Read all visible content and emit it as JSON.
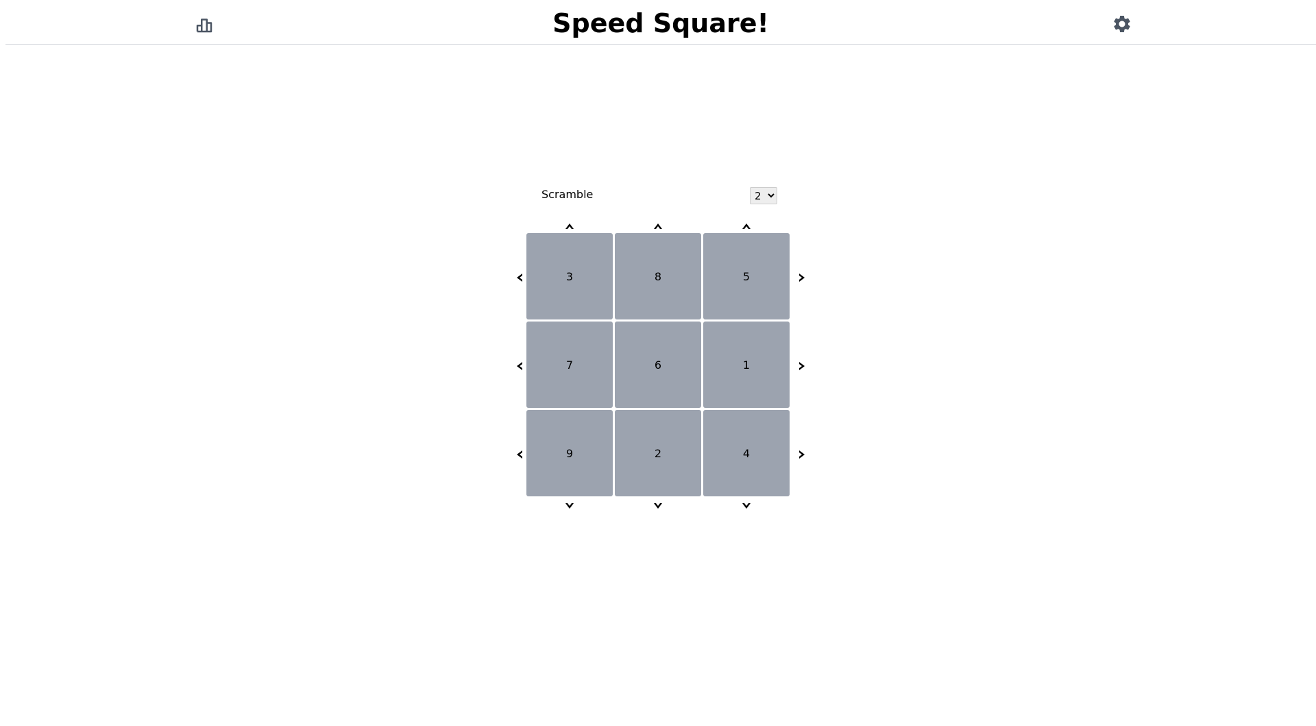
{
  "header": {
    "title": "Speed Square!",
    "stats_icon": "bar-chart-icon",
    "settings_icon": "gear-icon"
  },
  "controls": {
    "scramble_label": "Scramble",
    "scramble_value": "2",
    "scramble_options": [
      "2"
    ]
  },
  "board": {
    "rows": [
      [
        "3",
        "8",
        "5"
      ],
      [
        "7",
        "6",
        "1"
      ],
      [
        "9",
        "2",
        "4"
      ]
    ]
  },
  "colors": {
    "tile": "#9ca3af",
    "icon": "#4b5563",
    "divider": "#d1d5db"
  }
}
